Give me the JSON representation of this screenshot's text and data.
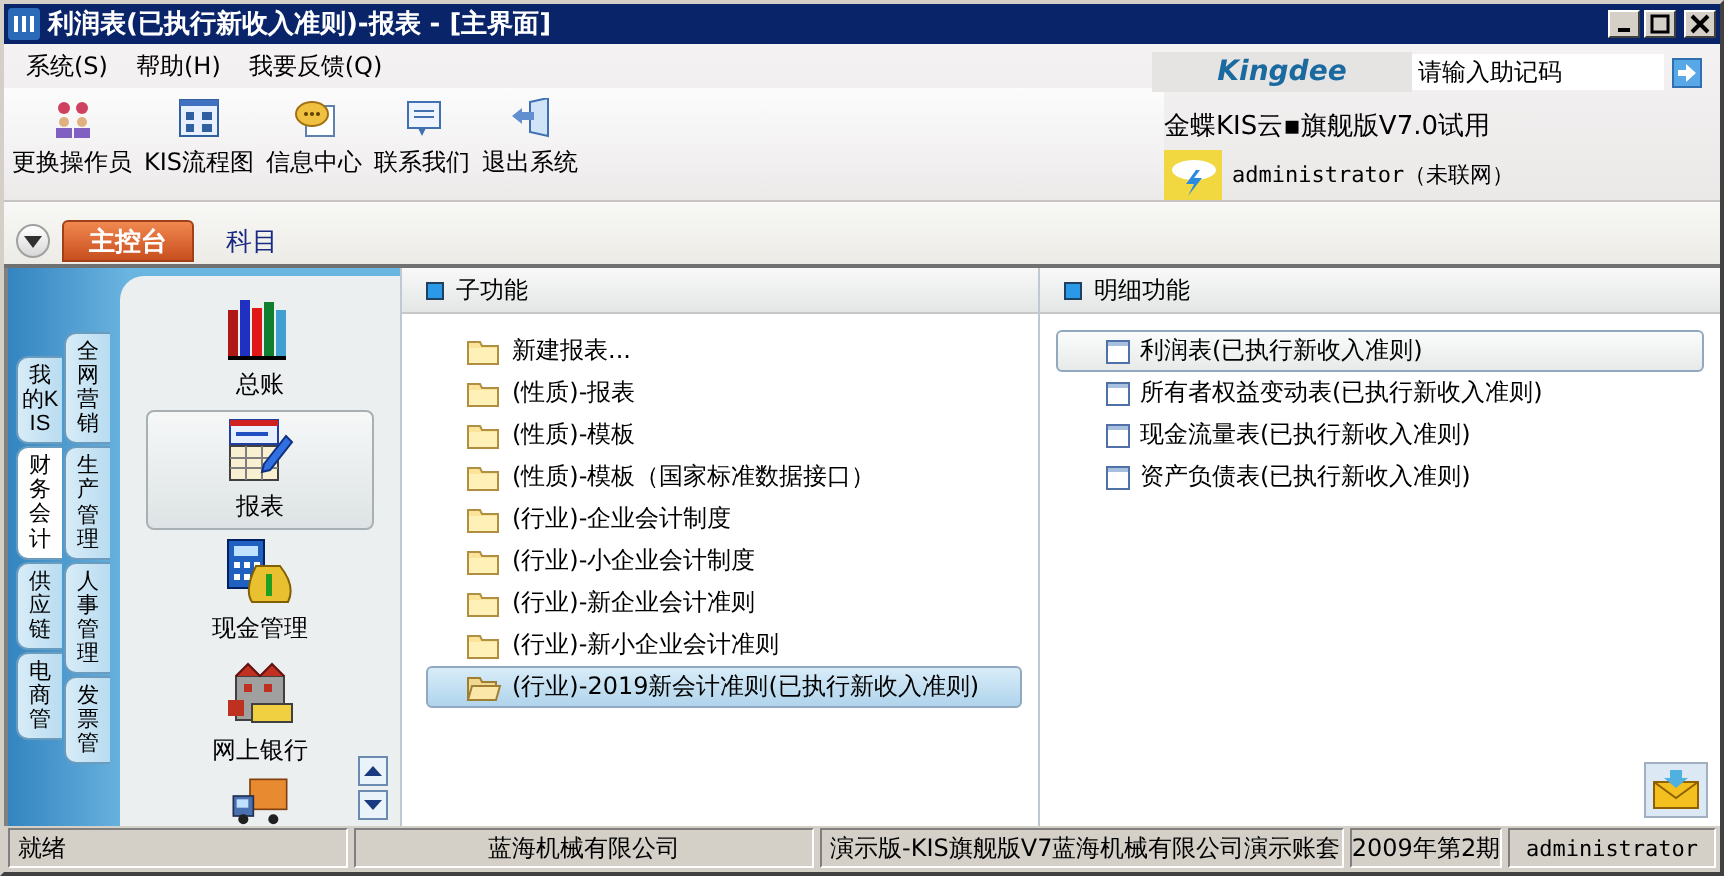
{
  "window": {
    "title": "利润表(已执行新收入准则)-报表 - [主界面]"
  },
  "menu": [
    {
      "label": "系统(S)"
    },
    {
      "label": "帮助(H)"
    },
    {
      "label": "我要反馈(Q)"
    }
  ],
  "toolbar": [
    {
      "label": "更换操作员"
    },
    {
      "label": "KIS流程图"
    },
    {
      "label": "信息中心"
    },
    {
      "label": "联系我们"
    },
    {
      "label": "退出系统"
    }
  ],
  "brand": {
    "logo": "Kingdee",
    "search": {
      "placeholder": "请输入助记码"
    },
    "product": "金蝶KIS云▪旗舰版V7.0试用",
    "user": "administrator（未联网）"
  },
  "tabs": [
    {
      "label": "主控台",
      "selected": true
    },
    {
      "label": "科目",
      "selected": false
    }
  ],
  "nav_tabs": {
    "column_1": [
      {
        "label": "我的KIS",
        "selected": false
      },
      {
        "label": "财务会计",
        "selected": true
      },
      {
        "label": "供应链",
        "selected": false
      },
      {
        "label": "电商管",
        "selected": false
      }
    ],
    "column_2": [
      {
        "label": "全网营销"
      },
      {
        "label": "生产管理"
      },
      {
        "label": "人事管理"
      },
      {
        "label": "发票管"
      }
    ]
  },
  "modules": [
    {
      "label": "总账",
      "selected": false
    },
    {
      "label": "报表",
      "selected": true
    },
    {
      "label": "现金管理",
      "selected": false
    },
    {
      "label": "网上银行",
      "selected": false
    }
  ],
  "sub_functions": {
    "title": "子功能",
    "items": [
      {
        "label": "新建报表...",
        "selected": false
      },
      {
        "label": "(性质)-报表",
        "selected": false
      },
      {
        "label": "(性质)-模板",
        "selected": false
      },
      {
        "label": "(性质)-模板（国家标准数据接口）",
        "selected": false
      },
      {
        "label": "(行业)-企业会计制度",
        "selected": false
      },
      {
        "label": "(行业)-小企业会计制度",
        "selected": false
      },
      {
        "label": "(行业)-新企业会计准则",
        "selected": false
      },
      {
        "label": "(行业)-新小企业会计准则",
        "selected": false
      },
      {
        "label": "(行业)-2019新会计准则(已执行新收入准则)",
        "selected": true
      }
    ]
  },
  "detail_functions": {
    "title": "明细功能",
    "items": [
      {
        "label": "利润表(已执行新收入准则)",
        "selected": true
      },
      {
        "label": "所有者权益变动表(已执行新收入准则)",
        "selected": false
      },
      {
        "label": "现金流量表(已执行新收入准则)",
        "selected": false
      },
      {
        "label": "资产负债表(已执行新收入准则)",
        "selected": false
      }
    ]
  },
  "status_bar": [
    "就绪",
    "蓝海机械有限公司",
    "演示版-KIS旗舰版V7蓝海机械有限公司演示账套",
    "2009年第2期",
    "administrator"
  ]
}
